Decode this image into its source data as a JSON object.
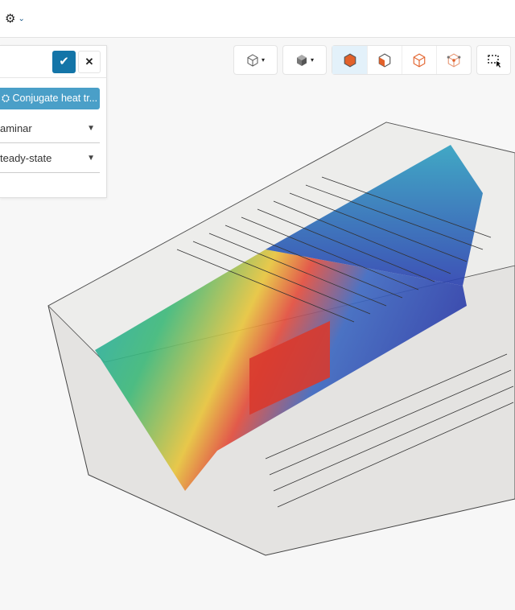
{
  "topbar": {
    "settings_icon": "gear-icon",
    "chevron_icon": "chevron-down-icon"
  },
  "panel": {
    "confirm_icon": "check-icon",
    "confirm_glyph": "✔",
    "close_icon": "close-icon",
    "close_glyph": "✕",
    "chip_label": "Conjugate heat tr...",
    "chip_icon": "cubes-icon",
    "selects": [
      {
        "value": "aminar"
      },
      {
        "value": "teady-state"
      }
    ],
    "select_arrow": "▼"
  },
  "toolbar": {
    "groups": [
      "view-cube-dropdown",
      "shaded-cube-dropdown",
      "select-solid",
      "select-face",
      "select-edge",
      "select-vertex",
      "box-select"
    ],
    "caret": "▾"
  },
  "colors": {
    "accent": "#1475a8",
    "chip": "#4a9fc8",
    "active_tool": "#e3f1fa",
    "highlight": "#e2612a"
  }
}
